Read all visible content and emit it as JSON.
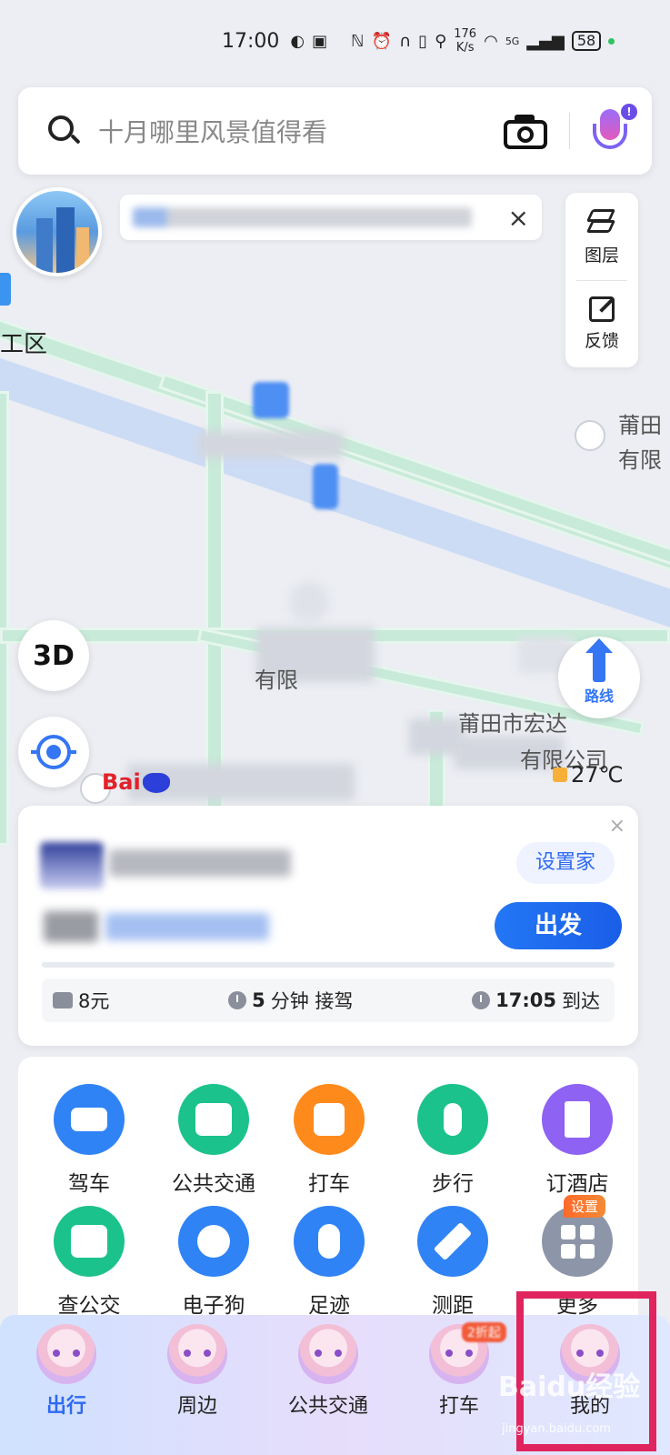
{
  "status_bar": {
    "time": "17:00",
    "speed_value": "176",
    "speed_unit": "K/s",
    "network": "5G",
    "battery": "58"
  },
  "search": {
    "placeholder": "十月哪里风景值得看"
  },
  "side_panel": {
    "layers_label": "图层",
    "feedback_label": "反馈"
  },
  "map": {
    "labels": [
      "工区",
      "莆田",
      "有限",
      "莆田市宏达",
      "有限",
      "有限公司"
    ],
    "route_label": "路线",
    "button_3d": "3D",
    "temperature": "27℃",
    "logo_text": "Bai"
  },
  "trip_card": {
    "set_home_label": "设置家",
    "go_label": "出发",
    "price": "8元",
    "pickup_value": "5",
    "pickup_text": "分钟 接驾",
    "arrive_time": "17:05",
    "arrive_text": "到达"
  },
  "services": [
    {
      "label": "驾车",
      "icon": "car-icon",
      "color": "#2f83f5"
    },
    {
      "label": "公共交通",
      "icon": "bus-icon",
      "color": "#1cc28c"
    },
    {
      "label": "打车",
      "icon": "taxi-icon",
      "color": "#ff8a1c"
    },
    {
      "label": "步行",
      "icon": "walk-icon",
      "color": "#1cc28c"
    },
    {
      "label": "订酒店",
      "icon": "hotel-icon",
      "color": "#8e62f2"
    },
    {
      "label": "查公交",
      "icon": "bus-stop-icon",
      "color": "#1cc28c"
    },
    {
      "label": "电子狗",
      "icon": "camera-dog-icon",
      "color": "#2f83f5"
    },
    {
      "label": "足迹",
      "icon": "footprint-icon",
      "color": "#2f83f5"
    },
    {
      "label": "测距",
      "icon": "ruler-icon",
      "color": "#2f83f5"
    },
    {
      "label": "更多",
      "icon": "grid-more-icon",
      "color": "#8d96a8"
    }
  ],
  "more_tag": "设置",
  "nav": [
    {
      "label": "出行",
      "active": true
    },
    {
      "label": "周边",
      "active": false
    },
    {
      "label": "公共交通",
      "active": false
    },
    {
      "label": "打车",
      "active": false
    },
    {
      "label": "我的",
      "active": false
    }
  ],
  "nav_badge": "2折起",
  "watermark": "Baidu经验",
  "watermark_url": "jingyan.baidu.com"
}
